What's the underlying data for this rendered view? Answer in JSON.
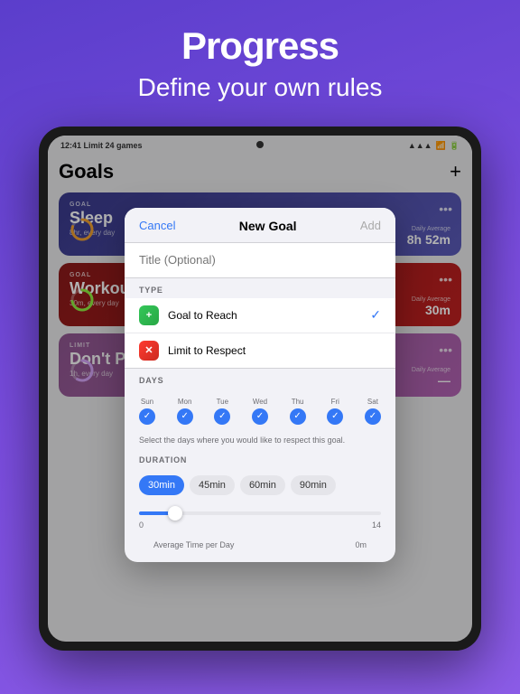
{
  "header": {
    "title": "Progress",
    "subtitle": "Define your own rules"
  },
  "status_bar": {
    "left": "12:41  Limit 24 games",
    "signal": "▲▲▲",
    "wifi": "wifi",
    "battery": "■■■"
  },
  "goals_screen": {
    "title": "Goals",
    "add_button": "+",
    "cards": [
      {
        "id": "sleep",
        "type_label": "GOAL",
        "name": "Sleep",
        "sub": "8hr, every day",
        "avg_label": "Daily Average",
        "avg_value": "8h 52m",
        "more": "•••"
      },
      {
        "id": "workout",
        "type_label": "GOAL",
        "name": "Workout",
        "sub": "30m, every day",
        "avg_label": "Daily Average",
        "avg_value": "30m",
        "more": "•••"
      },
      {
        "id": "limit",
        "type_label": "LIMIT",
        "name": "Don't Play Too M",
        "sub": "1h, every day",
        "avg_label": "Daily Average",
        "avg_value": "—",
        "more": "•••"
      }
    ]
  },
  "modal": {
    "cancel_label": "Cancel",
    "title": "New Goal",
    "add_label": "Add",
    "input_placeholder": "Title (Optional)",
    "type_section_label": "TYPE",
    "types": [
      {
        "id": "goal_to_reach",
        "label": "Goal to Reach",
        "selected": true
      },
      {
        "id": "limit_to_respect",
        "label": "Limit to Respect",
        "selected": false
      }
    ],
    "days_section_label": "DAYS",
    "days": [
      {
        "label": "Sun",
        "active": true
      },
      {
        "label": "Mon",
        "active": true
      },
      {
        "label": "Tue",
        "active": true
      },
      {
        "label": "Wed",
        "active": true
      },
      {
        "label": "Thu",
        "active": true
      },
      {
        "label": "Fri",
        "active": true
      },
      {
        "label": "Sat",
        "active": true
      }
    ],
    "days_note": "Select the days where you would like to respect this goal.",
    "duration_section_label": "DURATION",
    "duration_options": [
      {
        "label": "30min",
        "active": true
      },
      {
        "label": "45min",
        "active": false
      },
      {
        "label": "60min",
        "active": false
      },
      {
        "label": "90min",
        "active": false
      }
    ],
    "slider_min": "0",
    "slider_max": "14",
    "avg_label": "Average Time per Day",
    "avg_value": "0m"
  }
}
